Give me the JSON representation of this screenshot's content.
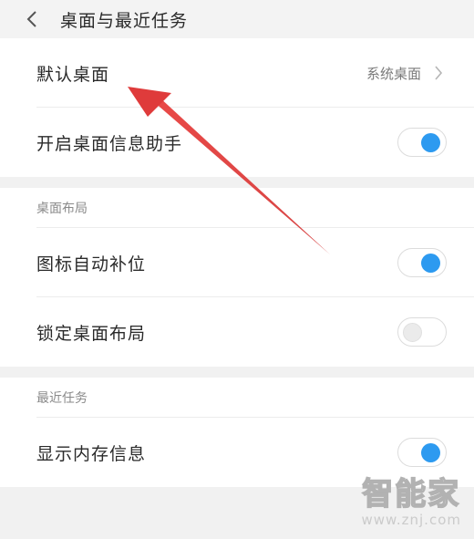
{
  "header": {
    "title": "桌面与最近任务"
  },
  "desktop_section": {
    "default_desktop_label": "默认桌面",
    "default_desktop_value": "系统桌面",
    "desktop_info_assistant_label": "开启桌面信息助手",
    "desktop_info_assistant_on": true
  },
  "layout_section": {
    "header": "桌面布局",
    "auto_fill_icons_label": "图标自动补位",
    "auto_fill_icons_on": true,
    "lock_layout_label": "锁定桌面布局",
    "lock_layout_on": false
  },
  "recent_section": {
    "header": "最近任务",
    "show_memory_label": "显示内存信息",
    "show_memory_on": true
  },
  "watermark": {
    "text": "智能家",
    "url": "www.znj.com"
  },
  "colors": {
    "accent": "#2d9af0",
    "annotation_arrow": "#e03a3a"
  },
  "icons": {
    "back": "chevron-left-icon",
    "forward": "chevron-right-icon"
  }
}
